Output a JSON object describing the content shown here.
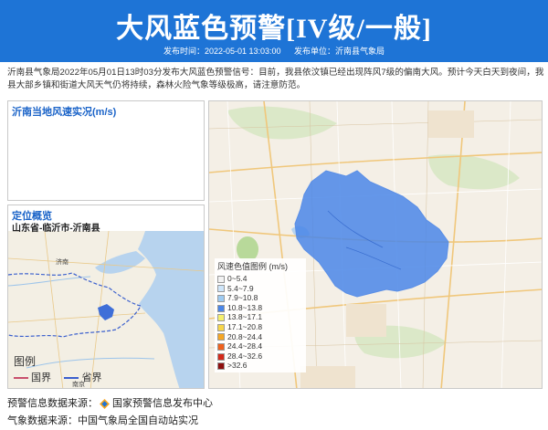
{
  "header": {
    "title": "大风蓝色预警[IV级/一般]",
    "publish_time": "发布时间：2022-05-01 13:03:00",
    "publisher": "发布单位：沂南县气象局",
    "color": "#1e74d6"
  },
  "description": "沂南县气象局2022年05月01日13时03分发布大风蓝色预警信号：目前，我县依汶镇已经出现阵风7级的偏南大风。预计今天白天到夜间，我县大部乡镇和街道大风天气仍将持续，森林火险气象等级极高，请注意防范。",
  "wind_chart": {
    "title": "沂南当地风速实况(m/s)"
  },
  "location": {
    "title": "定位概览",
    "path": "山东省-临沂市-沂南县",
    "legend_title": "图例",
    "legend_items": [
      {
        "label": "国界",
        "color": "#c94f6d"
      },
      {
        "label": "省界",
        "color": "#3a5fcd"
      }
    ],
    "map_labels": [
      "济南",
      "南京"
    ]
  },
  "wind_legend": {
    "title": "风速色值图例 (m/s)",
    "items": [
      {
        "label": "0~5.4",
        "color": "#f2f2f2"
      },
      {
        "label": "5.4~7.9",
        "color": "#cfe6fa"
      },
      {
        "label": "7.9~10.8",
        "color": "#9ecbf2"
      },
      {
        "label": "10.8~13.8",
        "color": "#4a86e8"
      },
      {
        "label": "13.8~17.1",
        "color": "#f5f06c"
      },
      {
        "label": "17.1~20.8",
        "color": "#f7d64a"
      },
      {
        "label": "20.8~24.4",
        "color": "#f6a623"
      },
      {
        "label": "24.4~28.4",
        "color": "#f0611c"
      },
      {
        "label": "28.4~32.6",
        "color": "#d42a1a"
      },
      {
        "label": ">32.6",
        "color": "#8e0f0f"
      }
    ]
  },
  "footer": {
    "warning_source_label": "预警信息数据来源：",
    "warning_source": "国家预警信息发布中心",
    "weather_source": "气象数据来源：中国气象局全国自动站实况"
  }
}
